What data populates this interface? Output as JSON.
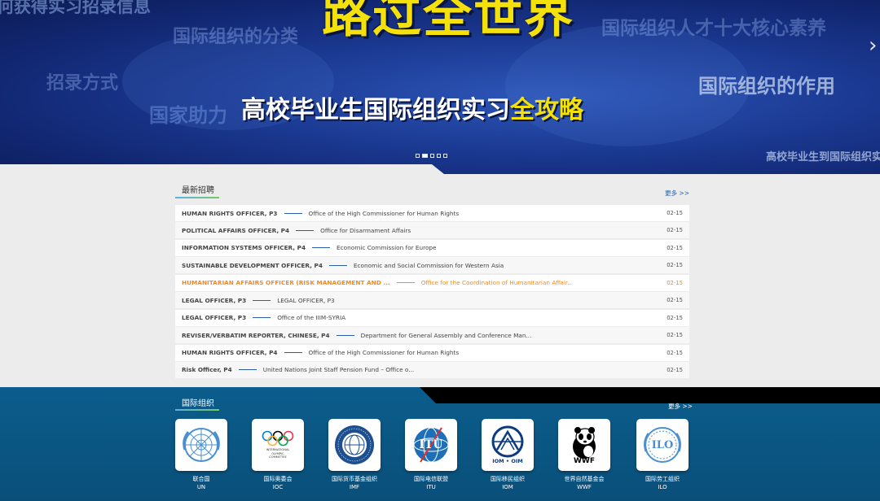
{
  "banner": {
    "bg_words": [
      "何获得实习招录信息",
      "国际组织的分类",
      "招录方式",
      "国家助力",
      "国际组织人才十大核心素养",
      "国际组织的作用",
      "高校毕业生到国际组织实"
    ],
    "hero_top": "路过全世界",
    "hero_bottom_main": "高校毕业生国际组织实习",
    "hero_bottom_highlight": "全攻略",
    "next_arrow": "›",
    "slide_count": 5,
    "active_slide": 2
  },
  "jobs": {
    "title": "最新招聘",
    "more": "更多 >>",
    "rows": [
      {
        "title": "HUMAN RIGHTS OFFICER, P3",
        "org": "Office of the High Commissioner for Human Rights",
        "date": "02-15",
        "highlight": false
      },
      {
        "title": "POLITICAL AFFAIRS OFFICER, P4",
        "org": "Office for Disarmament Affairs",
        "date": "02-15",
        "highlight": false
      },
      {
        "title": "INFORMATION SYSTEMS OFFICER, P4",
        "org": "Economic Commission for Europe",
        "date": "02-15",
        "highlight": false
      },
      {
        "title": "SUSTAINABLE DEVELOPMENT OFFICER, P4",
        "org": "Economic and Social Commission for Western Asia",
        "date": "02-15",
        "highlight": false
      },
      {
        "title": "HUMANITARIAN AFFAIRS OFFICER (RISK MANAGEMENT AND ...",
        "org": "Office for the Coordination of Humanitarian Affair...",
        "date": "02-15",
        "highlight": true
      },
      {
        "title": "LEGAL OFFICER, P3",
        "org": "LEGAL OFFICER, P3",
        "date": "02-15",
        "highlight": false
      },
      {
        "title": "LEGAL OFFICER, P3",
        "org": "Office of the IIIM-SYRIA",
        "date": "02-15",
        "highlight": false
      },
      {
        "title": "REVISER/VERBATIM REPORTER, CHINESE, P4",
        "org": "Department for General Assembly and Conference Man...",
        "date": "02-15",
        "highlight": false
      },
      {
        "title": "HUMAN RIGHTS OFFICER, P4",
        "org": "Office of the High Commissioner for Human Rights",
        "date": "02-15",
        "highlight": false
      },
      {
        "title": "Risk Officer, P4",
        "org": "United Nations Joint Staff Pension Fund – Office o...",
        "date": "02-15",
        "highlight": false
      }
    ]
  },
  "orgs": {
    "title": "国际组织",
    "more": "更多 >>",
    "items": [
      {
        "name": "联合国",
        "abbr": "UN",
        "icon": "un-emblem-icon"
      },
      {
        "name": "国际奥委会",
        "abbr": "IOC",
        "icon": "olympic-rings-icon",
        "logo_text": [
          "INTERNATIONAL",
          "OLYMPIC",
          "COMMITTEE"
        ]
      },
      {
        "name": "国际货币基金组织",
        "abbr": "IMF",
        "icon": "imf-seal-icon"
      },
      {
        "name": "国际电信联盟",
        "abbr": "ITU",
        "icon": "itu-logo-icon",
        "logo_text": [
          "ITU"
        ]
      },
      {
        "name": "国际移民组织",
        "abbr": "IOM",
        "icon": "iom-logo-icon",
        "logo_text": [
          "IOM • OIM"
        ]
      },
      {
        "name": "世界自然基金会",
        "abbr": "WWF",
        "icon": "panda-icon",
        "logo_text": [
          "WWF"
        ]
      },
      {
        "name": "国际劳工组织",
        "abbr": "ILO",
        "icon": "ilo-emblem-icon",
        "logo_text": [
          "ILO"
        ]
      }
    ]
  },
  "colors": {
    "banner_blue": "#1b3a93",
    "hero_yellow": "#f4e10c",
    "highlight_orange": "#f08a24",
    "org_section_blue": "#0b5d8c",
    "link_blue": "#1f5ea8"
  }
}
